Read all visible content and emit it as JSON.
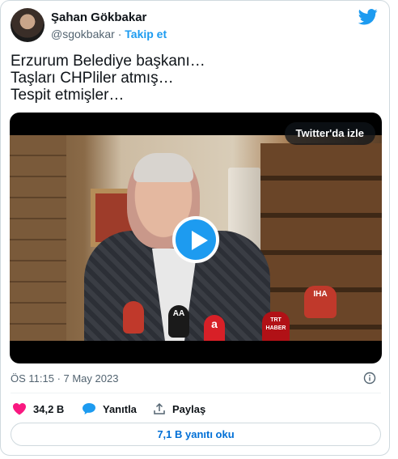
{
  "author": {
    "name": "Şahan Gökbakar",
    "handle": "@sgokbakar",
    "separator": "·",
    "follow_label": "Takip et"
  },
  "tweet": {
    "lines": [
      "Erzurum Belediye başkanı…",
      "Taşları CHPliler atmış…",
      "Tespit etmişler…"
    ]
  },
  "video": {
    "watch_label": "Twitter'da izle",
    "mic_labels": [
      "AA",
      "IHA",
      "TRT HABER",
      "a"
    ]
  },
  "timestamp": "ÖS 11:15 · 7 May 2023",
  "actions": {
    "likes": "34,2 B",
    "reply_label": "Yanıtla",
    "share_label": "Paylaş"
  },
  "read_replies_label": "7,1 B yanıtı oku",
  "colors": {
    "accent": "#1d9bf0",
    "like": "#f91880",
    "link": "#006fd6",
    "text": "#0f1419",
    "muted": "#536471"
  },
  "icons": {
    "brand": "twitter-bird-icon",
    "like": "heart-icon",
    "reply": "speech-bubble-icon",
    "share": "share-arrow-icon",
    "info": "info-icon",
    "play": "play-icon"
  }
}
